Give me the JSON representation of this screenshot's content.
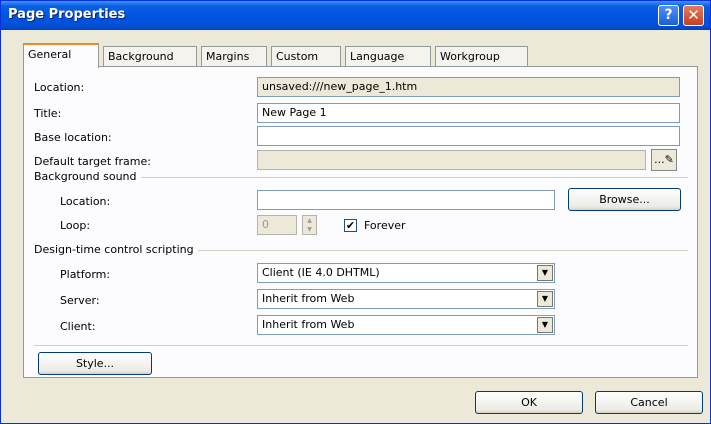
{
  "window": {
    "title": "Page Properties",
    "help_glyph": "?",
    "close_glyph": "✕"
  },
  "tabs": [
    {
      "label": "General",
      "active": true
    },
    {
      "label": "Background",
      "active": false
    },
    {
      "label": "Margins",
      "active": false
    },
    {
      "label": "Custom",
      "active": false
    },
    {
      "label": "Language",
      "active": false
    },
    {
      "label": "Workgroup",
      "active": false
    }
  ],
  "general": {
    "location_label": "Location:",
    "location_value": "unsaved:///new_page_1.htm",
    "title_label": "Title:",
    "title_value": "New Page 1",
    "base_location_label": "Base location:",
    "base_location_value": "",
    "default_target_label": "Default target frame:",
    "default_target_value": "",
    "pencil_glyph": "...✎"
  },
  "background_sound": {
    "group_label": "Background sound",
    "location_label": "Location:",
    "location_value": "",
    "browse_label": "Browse...",
    "loop_label": "Loop:",
    "loop_value": "0",
    "forever_label": "Forever",
    "forever_checked": true
  },
  "design_time": {
    "group_label": "Design-time control scripting",
    "platform_label": "Platform:",
    "platform_value": "Client (IE 4.0 DHTML)",
    "server_label": "Server:",
    "server_value": "Inherit from Web",
    "client_label": "Client:",
    "client_value": "Inherit from Web"
  },
  "style_button": "Style...",
  "footer": {
    "ok_label": "OK",
    "cancel_label": "Cancel"
  },
  "colors": {
    "titlebar": "#0055E5",
    "dialog_bg": "#ECE9D8",
    "panel_bg": "#FCFCFE",
    "active_tab_accent": "#E68B2C"
  },
  "icons": {
    "help": "help-icon",
    "close": "close-icon",
    "dropdown": "chevron-down-icon",
    "checkbox": "check-icon",
    "pencil": "pencil-icon"
  }
}
